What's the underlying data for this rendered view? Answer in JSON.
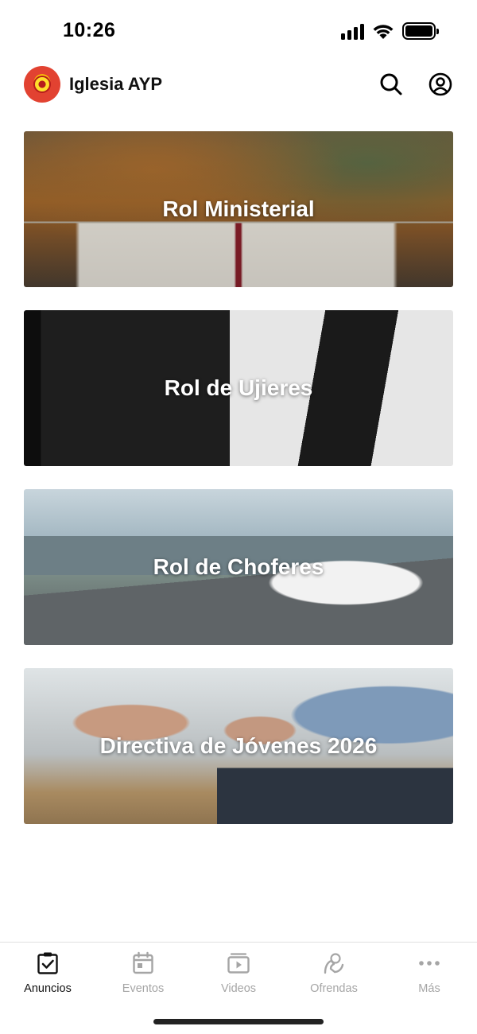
{
  "status_bar": {
    "time": "10:26",
    "icons": [
      "signal-icon",
      "wifi-icon",
      "battery-icon"
    ]
  },
  "header": {
    "logo_icon": "church-logo",
    "title": "Iglesia AYP",
    "actions": [
      "search-icon",
      "account-icon"
    ]
  },
  "cards": [
    {
      "title": "Rol Ministerial",
      "image": "open-bible-autumn"
    },
    {
      "title": "Rol de Ujieres",
      "image": "man-holding-bible-tie"
    },
    {
      "title": "Rol de Choferes",
      "image": "white-van-mountain-road"
    },
    {
      "title": "Directiva de Jóvenes 2026",
      "image": "praying-hands-holy-bible"
    }
  ],
  "bottom_nav": {
    "items": [
      {
        "label": "Anuncios",
        "icon": "clipboard-check-icon",
        "active": true
      },
      {
        "label": "Eventos",
        "icon": "calendar-icon",
        "active": false
      },
      {
        "label": "Videos",
        "icon": "video-play-icon",
        "active": false
      },
      {
        "label": "Ofrendas",
        "icon": "offering-hand-icon",
        "active": false
      },
      {
        "label": "Más",
        "icon": "more-dots-icon",
        "active": false
      }
    ]
  },
  "colors": {
    "active_nav": "#111111",
    "inactive_nav": "#a5a5a5",
    "logo_red": "#e24231",
    "logo_yellow": "#ffd400"
  }
}
